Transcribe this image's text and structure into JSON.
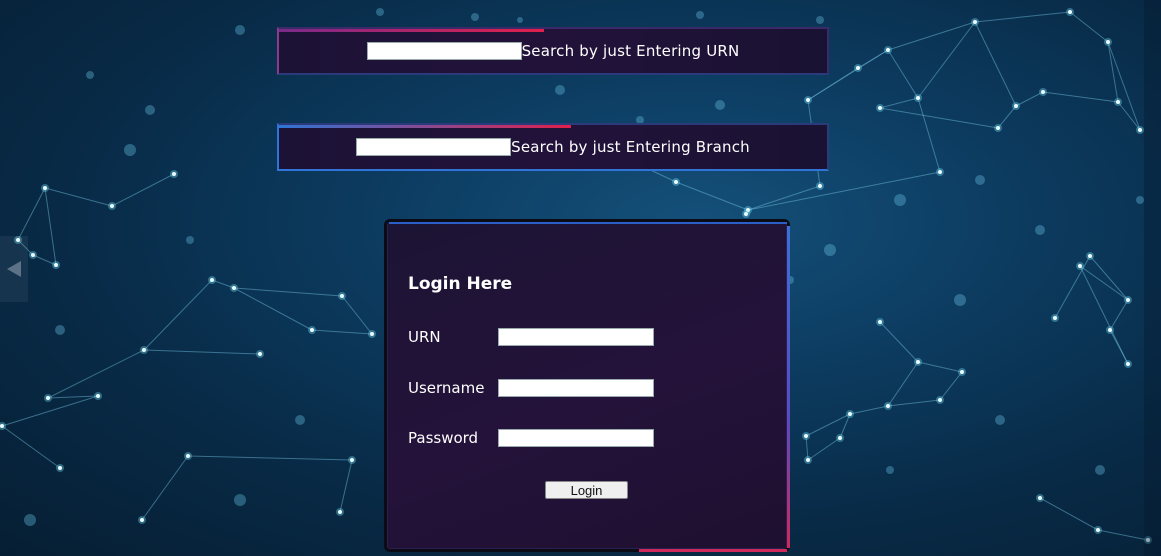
{
  "search_urn": {
    "label": "Search by just Entering URN",
    "value": ""
  },
  "search_branch": {
    "label": "Search by just Entering Branch",
    "value": ""
  },
  "login": {
    "title": "Login Here",
    "fields": [
      {
        "label": "URN",
        "value": ""
      },
      {
        "label": "Username",
        "value": ""
      },
      {
        "label": "Password",
        "value": ""
      }
    ],
    "button_label": "Login"
  },
  "icons": {
    "carousel_prev": "chevron-left-icon"
  },
  "colors": {
    "background": "#0c3a5e",
    "panel": "#22123a",
    "accent_blue": "#2f74d6",
    "accent_red": "#e0204a",
    "node_glow": "#7ee8ff"
  }
}
